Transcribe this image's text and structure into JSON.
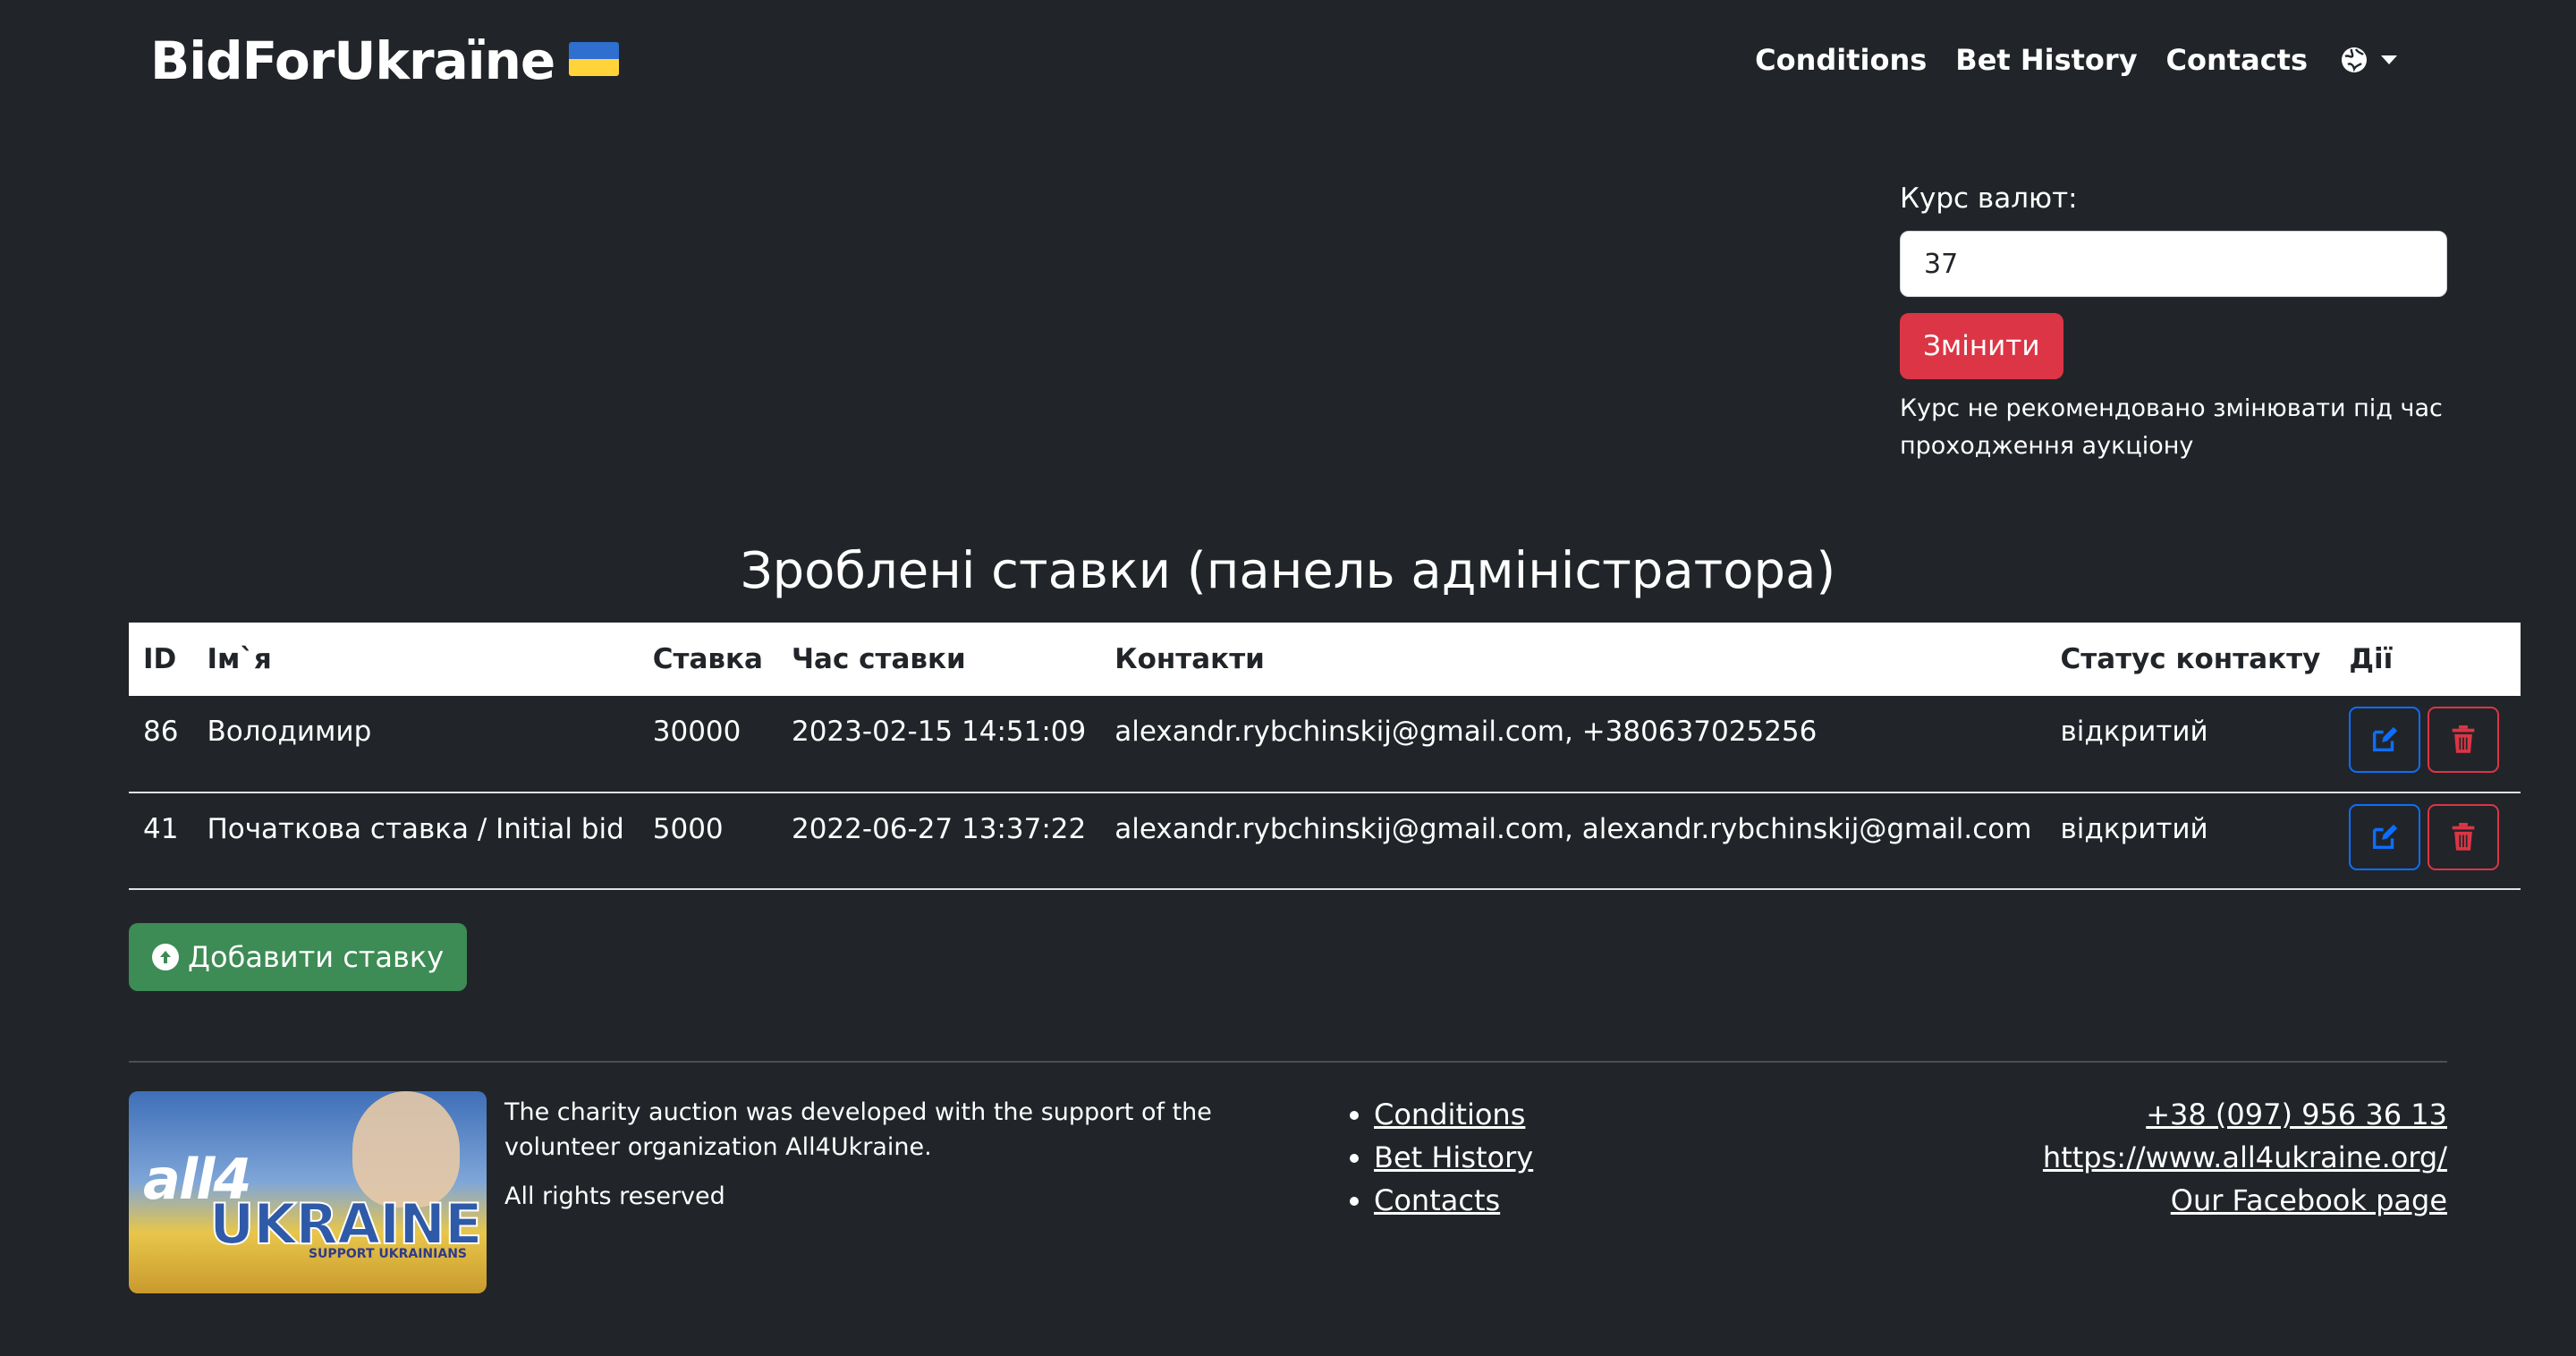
{
  "brand": {
    "name": "BidForUkraïne",
    "flag_colors": [
      "#2f6fd0",
      "#ffd43b"
    ]
  },
  "nav": {
    "conditions": "Conditions",
    "bet_history": "Bet History",
    "contacts": "Contacts",
    "language_icon": "globe-icon"
  },
  "rate": {
    "label": "Курс валют:",
    "value": "37",
    "button": "Змінити",
    "note_line1": "Курс не рекомендовано змінювати під час",
    "note_line2": "проходження аукціону"
  },
  "bets": {
    "title": "Зроблені ставки (панель адміністратора)",
    "headers": {
      "id": "ID",
      "name": "Ім`я",
      "bid": "Ставка",
      "time": "Час ставки",
      "contacts": "Контакти",
      "status": "Статус контакту",
      "actions": "Дії"
    },
    "rows": [
      {
        "id": "86",
        "name": "Володимир",
        "bid": "30000",
        "time": "2023-02-15 14:51:09",
        "contacts": "alexandr.rybchinskij@gmail.com, +380637025256",
        "status": "відкритий"
      },
      {
        "id": "41",
        "name": "Початкова ставка / Initial bid",
        "bid": "5000",
        "time": "2022-06-27 13:37:22",
        "contacts": "alexandr.rybchinskij@gmail.com, alexandr.rybchinskij@gmail.com",
        "status": "відкритий"
      }
    ],
    "add_button": "Добавити ставку"
  },
  "footer": {
    "logo": {
      "line1": "all4",
      "line2": "UKRAINE",
      "tagline": "SUPPORT UKRAINIANS"
    },
    "about_1": "The charity auction was developed with the support of the volunteer organization All4Ukraine.",
    "about_2": "All rights reserved",
    "links": [
      "Conditions",
      "Bet History",
      "Contacts"
    ],
    "phone": "+38 (097) 956 36 13",
    "website": "https://www.all4ukraine.org/",
    "facebook": "Our Facebook page"
  },
  "colors": {
    "background": "#212529",
    "danger": "#dc3545",
    "primary": "#0d6efd",
    "success": "#3d8b55"
  }
}
